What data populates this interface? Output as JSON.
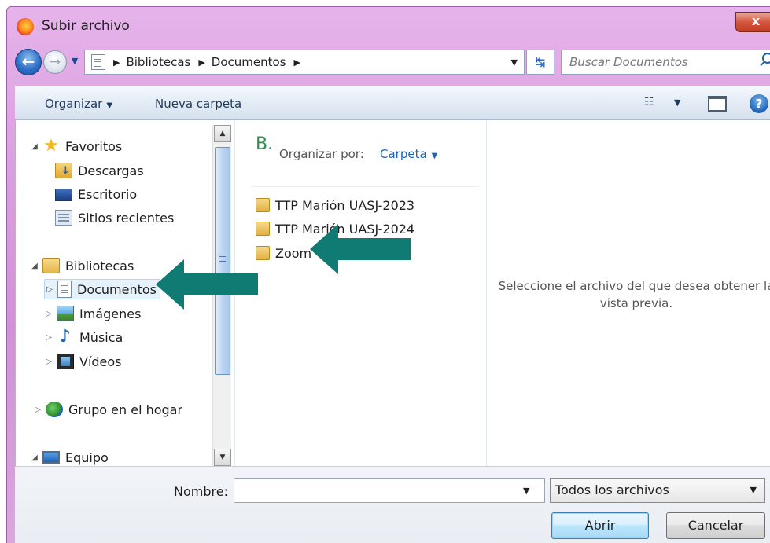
{
  "window": {
    "title": "Subir archivo",
    "close_label": "x"
  },
  "address": {
    "crumbs": [
      "Bibliotecas",
      "Documentos"
    ],
    "search_placeholder": "Buscar Documentos"
  },
  "toolbar": {
    "organize_label": "Organizar",
    "new_folder_label": "Nueva carpeta",
    "help_label": "?"
  },
  "nav": {
    "favorites": {
      "label": "Favoritos",
      "items": [
        "Descargas",
        "Escritorio",
        "Sitios recientes"
      ]
    },
    "libraries": {
      "label": "Bibliotecas",
      "items": [
        "Documentos",
        "Imágenes",
        "Música",
        "Vídeos"
      ]
    },
    "homegroup": "Grupo en el hogar",
    "computer": "Equipo"
  },
  "files": {
    "library_mark": "B.",
    "arrange_label": "Organizar por:",
    "arrange_value": "Carpeta",
    "items": [
      "TTP Marión UASJ-2023",
      "TTP Marión UASJ-2024",
      "Zoom"
    ]
  },
  "preview": {
    "message": "Seleccione el archivo del que desea obtener la vista previa."
  },
  "bottom": {
    "name_label": "Nombre:",
    "name_value": "",
    "file_type": "Todos los archivos",
    "open_label": "Abrir",
    "cancel_label": "Cancelar"
  },
  "colors": {
    "annotation_arrow": "#0f7b72",
    "title_bar": "#d9a0df",
    "link_blue": "#1e63b8"
  }
}
